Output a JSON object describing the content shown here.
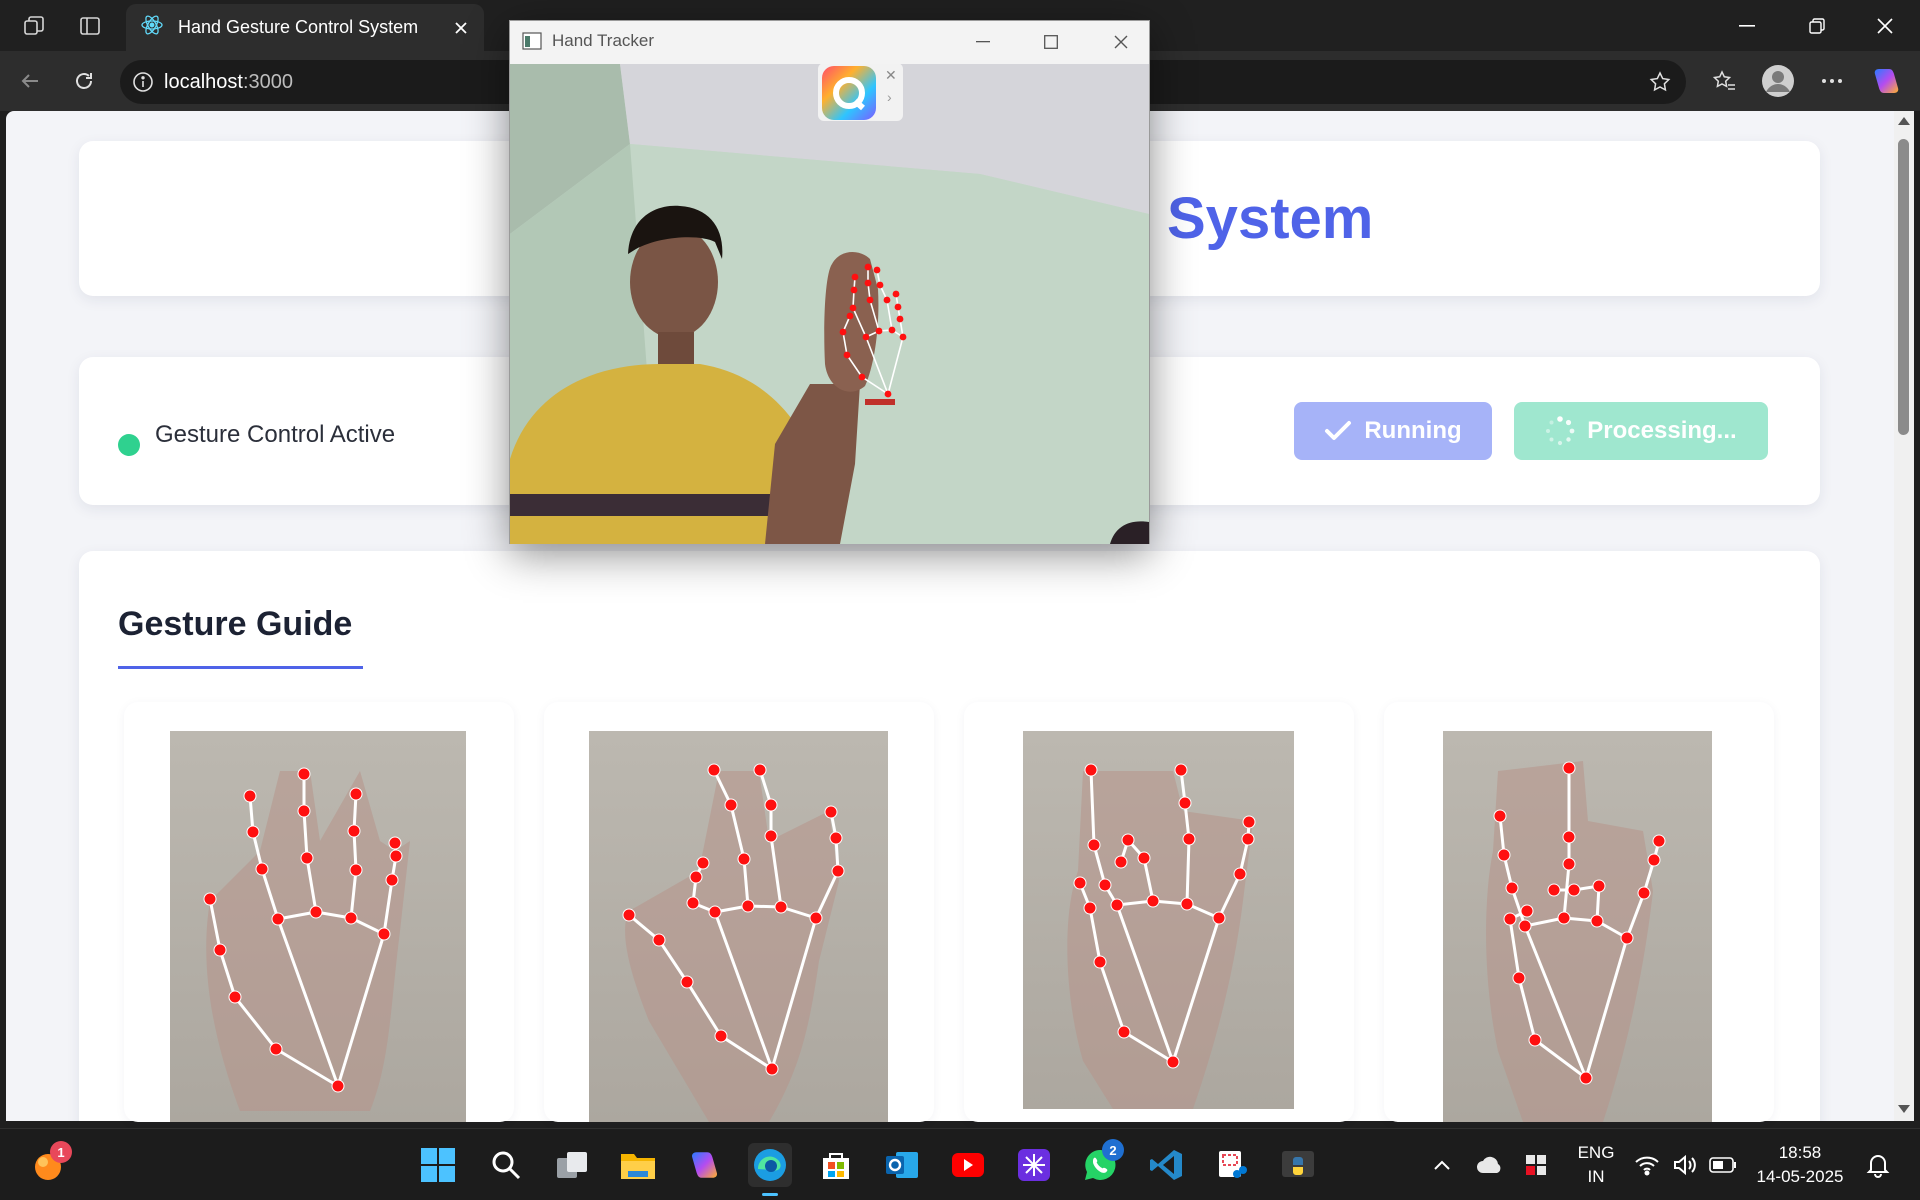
{
  "browser": {
    "tab_title": "Hand Gesture Control System",
    "url_host": "localhost",
    "url_port": ":3000"
  },
  "page": {
    "header_title_visible": "System",
    "status_label": "Gesture Control Active",
    "status_color": "#2fd18f",
    "running_label": "Running",
    "processing_label": "Processing...",
    "guide_title": "Gesture Guide",
    "accent_color": "#4f63e8"
  },
  "tracker": {
    "title": "Hand Tracker"
  },
  "taskbar": {
    "language_top": "ENG",
    "language_bottom": "IN",
    "time": "18:58",
    "date": "14-05-2025",
    "widgets_badge": "1",
    "whatsapp_badge": "2"
  },
  "icons": [
    "workspaces-icon",
    "tab-actions-icon",
    "react-icon",
    "close-icon",
    "back-icon",
    "reload-icon",
    "info-icon",
    "favorite-icon",
    "favorites-icon",
    "profile-icon",
    "more-icon",
    "copilot-icon",
    "check-icon",
    "spinner-icon",
    "windows-start-icon",
    "search-icon",
    "task-view-icon",
    "file-explorer-icon",
    "edge-icon",
    "store-icon",
    "outlook-icon",
    "youtube-icon",
    "whatsapp-icon",
    "vscode-icon",
    "python-icon",
    "wifi-icon",
    "volume-icon",
    "battery-icon",
    "notification-icon"
  ]
}
